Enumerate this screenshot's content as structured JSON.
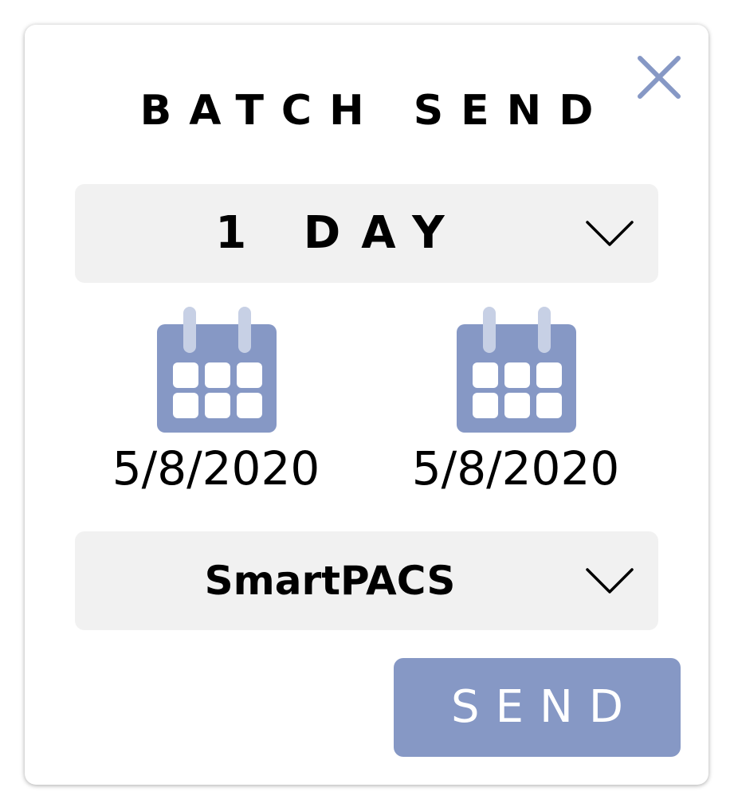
{
  "dialog": {
    "title": "BATCH SEND",
    "close_icon": "close-icon"
  },
  "range_select": {
    "selected": "1 DAY",
    "icon": "chevron-down-icon"
  },
  "dates": {
    "from": {
      "value": "5/8/2020",
      "icon": "calendar-icon"
    },
    "to": {
      "value": "5/8/2020",
      "icon": "calendar-icon"
    }
  },
  "destination_select": {
    "selected": "SmartPACS",
    "icon": "chevron-down-icon"
  },
  "actions": {
    "send_label": "SEND"
  },
  "colors": {
    "accent": "#8698c5",
    "accent_light": "#c7d0e5",
    "select_bg": "#f1f1f1",
    "text": "#000000"
  }
}
